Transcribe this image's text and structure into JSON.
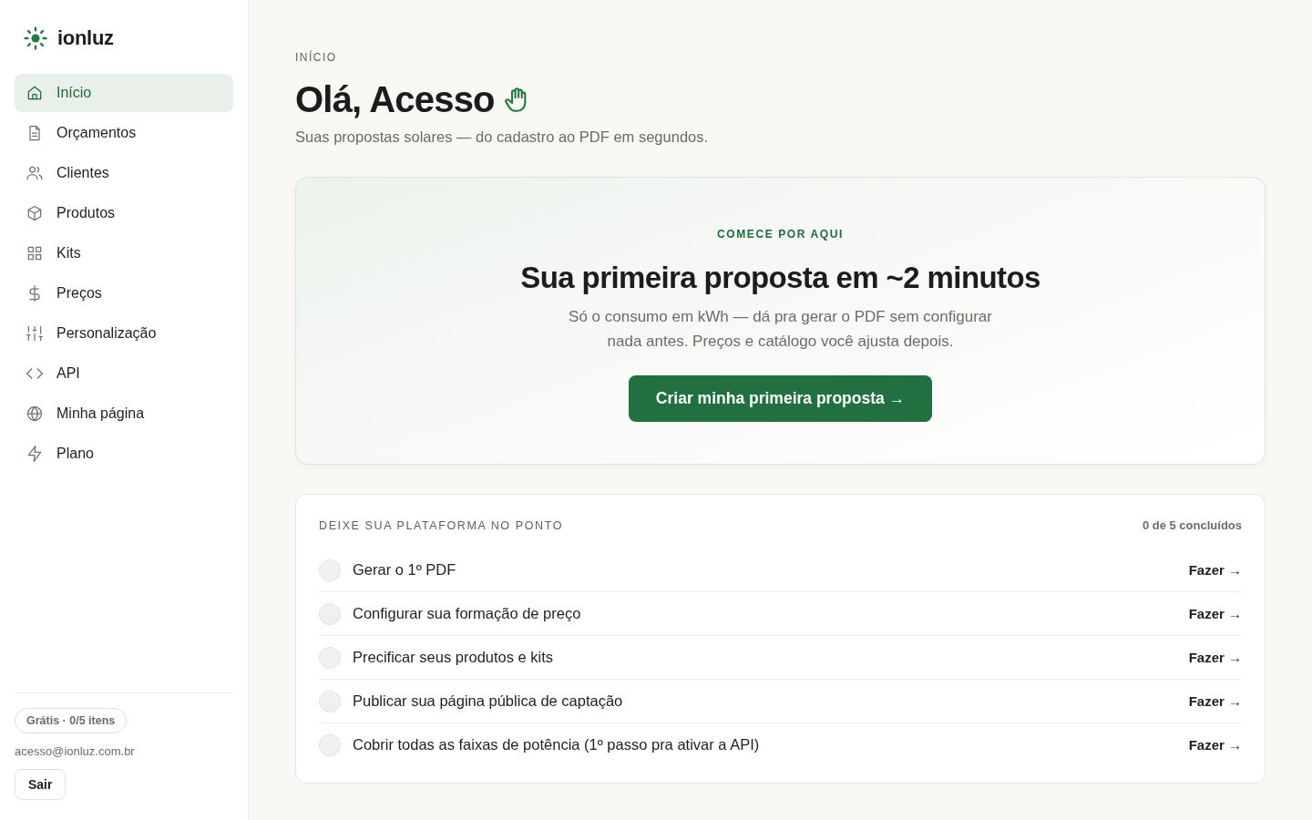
{
  "sidebar": {
    "brand": "ionluz",
    "nav": [
      {
        "label": "Início",
        "selected": true
      },
      {
        "label": "Orçamentos",
        "selected": false
      },
      {
        "label": "Clientes",
        "selected": false
      },
      {
        "label": "Produtos",
        "selected": false
      },
      {
        "label": "Kits",
        "selected": false
      },
      {
        "label": "Preços",
        "selected": false
      },
      {
        "label": "Personalização",
        "selected": false
      },
      {
        "label": "API",
        "selected": false
      },
      {
        "label": "Minha página",
        "selected": false
      },
      {
        "label": "Plano",
        "selected": false
      }
    ],
    "plan_badge": "Grátis · 0/5 itens",
    "user_email": "acesso@ionluz.com.br",
    "logout_button": "Sair"
  },
  "main": {
    "breadcrumb": "INÍCIO",
    "title": "Olá, Acesso",
    "subtitle": "Suas propostas solares — do cadastro ao PDF em segundos.",
    "hero": {
      "eyebrow": "COMECE POR AQUI",
      "title": "Sua primeira proposta em ~2 minutos",
      "text": "Só o consumo em kWh — dá pra gerar o PDF sem configurar nada antes. Preços e catálogo você ajusta depois.",
      "button": "Criar minha primeira proposta →"
    },
    "checklist": {
      "title": "DEIXE SUA PLATAFORMA NO PONTO",
      "summary": "0 de 5 concluídos",
      "items": [
        {
          "label": "Gerar o 1º PDF",
          "done": false,
          "action": "Fazer →"
        },
        {
          "label": "Configurar sua formação de preço",
          "done": false,
          "action": "Fazer →"
        },
        {
          "label": "Precificar seus produtos e kits",
          "done": false,
          "action": "Fazer →"
        },
        {
          "label": "Publicar sua página pública de captação",
          "done": false,
          "action": "Fazer →"
        },
        {
          "label": "Cobrir todas as faixas de potência (1º passo pra ativar a API)",
          "done": false,
          "action": "Fazer →"
        }
      ]
    }
  }
}
